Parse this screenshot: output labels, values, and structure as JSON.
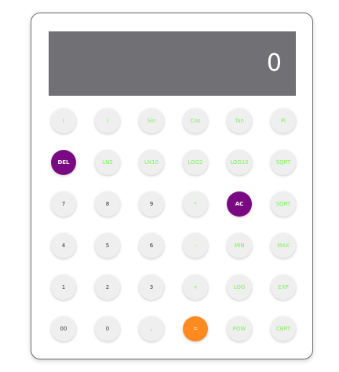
{
  "display": {
    "value": "0"
  },
  "colors": {
    "display_bg": "#717175",
    "function_text": "#7df05a",
    "purple_key": "#7a0a82",
    "orange_key": "#ff8a1f",
    "key_bg": "#efefef"
  },
  "keys": [
    {
      "label": "(",
      "name": "open-paren-button",
      "style": "fn"
    },
    {
      "label": ")",
      "name": "close-paren-button",
      "style": "fn"
    },
    {
      "label": "Sin",
      "name": "sin-button",
      "style": "fn"
    },
    {
      "label": "Cos",
      "name": "cos-button",
      "style": "fn"
    },
    {
      "label": "Tan",
      "name": "tan-button",
      "style": "fn"
    },
    {
      "label": "Pi",
      "name": "pi-button",
      "style": "fn"
    },
    {
      "label": "DEL",
      "name": "delete-button",
      "style": "purple"
    },
    {
      "label": "LN2",
      "name": "ln2-button",
      "style": "fn"
    },
    {
      "label": "LN10",
      "name": "ln10-button",
      "style": "fn"
    },
    {
      "label": "LOG2",
      "name": "log2-button",
      "style": "fn"
    },
    {
      "label": "LOG10",
      "name": "log10-button",
      "style": "fn"
    },
    {
      "label": "SQRT",
      "name": "sqrt-button",
      "style": "fn"
    },
    {
      "label": "7",
      "name": "digit-7-button",
      "style": "num"
    },
    {
      "label": "8",
      "name": "digit-8-button",
      "style": "num"
    },
    {
      "label": "9",
      "name": "digit-9-button",
      "style": "num"
    },
    {
      "label": "*",
      "name": "multiply-button",
      "style": "fn"
    },
    {
      "label": "AC",
      "name": "all-clear-button",
      "style": "purple"
    },
    {
      "label": "SQRT",
      "name": "sqrt-button-2",
      "style": "fn"
    },
    {
      "label": "4",
      "name": "digit-4-button",
      "style": "num"
    },
    {
      "label": "5",
      "name": "digit-5-button",
      "style": "num"
    },
    {
      "label": "6",
      "name": "digit-6-button",
      "style": "num"
    },
    {
      "label": "-",
      "name": "subtract-button",
      "style": "fn"
    },
    {
      "label": "MIN",
      "name": "min-button",
      "style": "fn"
    },
    {
      "label": "MAX",
      "name": "max-button",
      "style": "fn"
    },
    {
      "label": "1",
      "name": "digit-1-button",
      "style": "num"
    },
    {
      "label": "2",
      "name": "digit-2-button",
      "style": "num"
    },
    {
      "label": "3",
      "name": "digit-3-button",
      "style": "num"
    },
    {
      "label": "+",
      "name": "add-button",
      "style": "fn"
    },
    {
      "label": "LOG",
      "name": "log-button",
      "style": "fn"
    },
    {
      "label": "EXP",
      "name": "exp-button",
      "style": "fn"
    },
    {
      "label": "00",
      "name": "double-zero-button",
      "style": "num"
    },
    {
      "label": "0",
      "name": "digit-0-button",
      "style": "num"
    },
    {
      "label": ".",
      "name": "decimal-point-button",
      "style": "num"
    },
    {
      "label": "=",
      "name": "equals-button",
      "style": "orange"
    },
    {
      "label": "POW",
      "name": "pow-button",
      "style": "fn"
    },
    {
      "label": "CBRT",
      "name": "cbrt-button",
      "style": "fn"
    }
  ]
}
